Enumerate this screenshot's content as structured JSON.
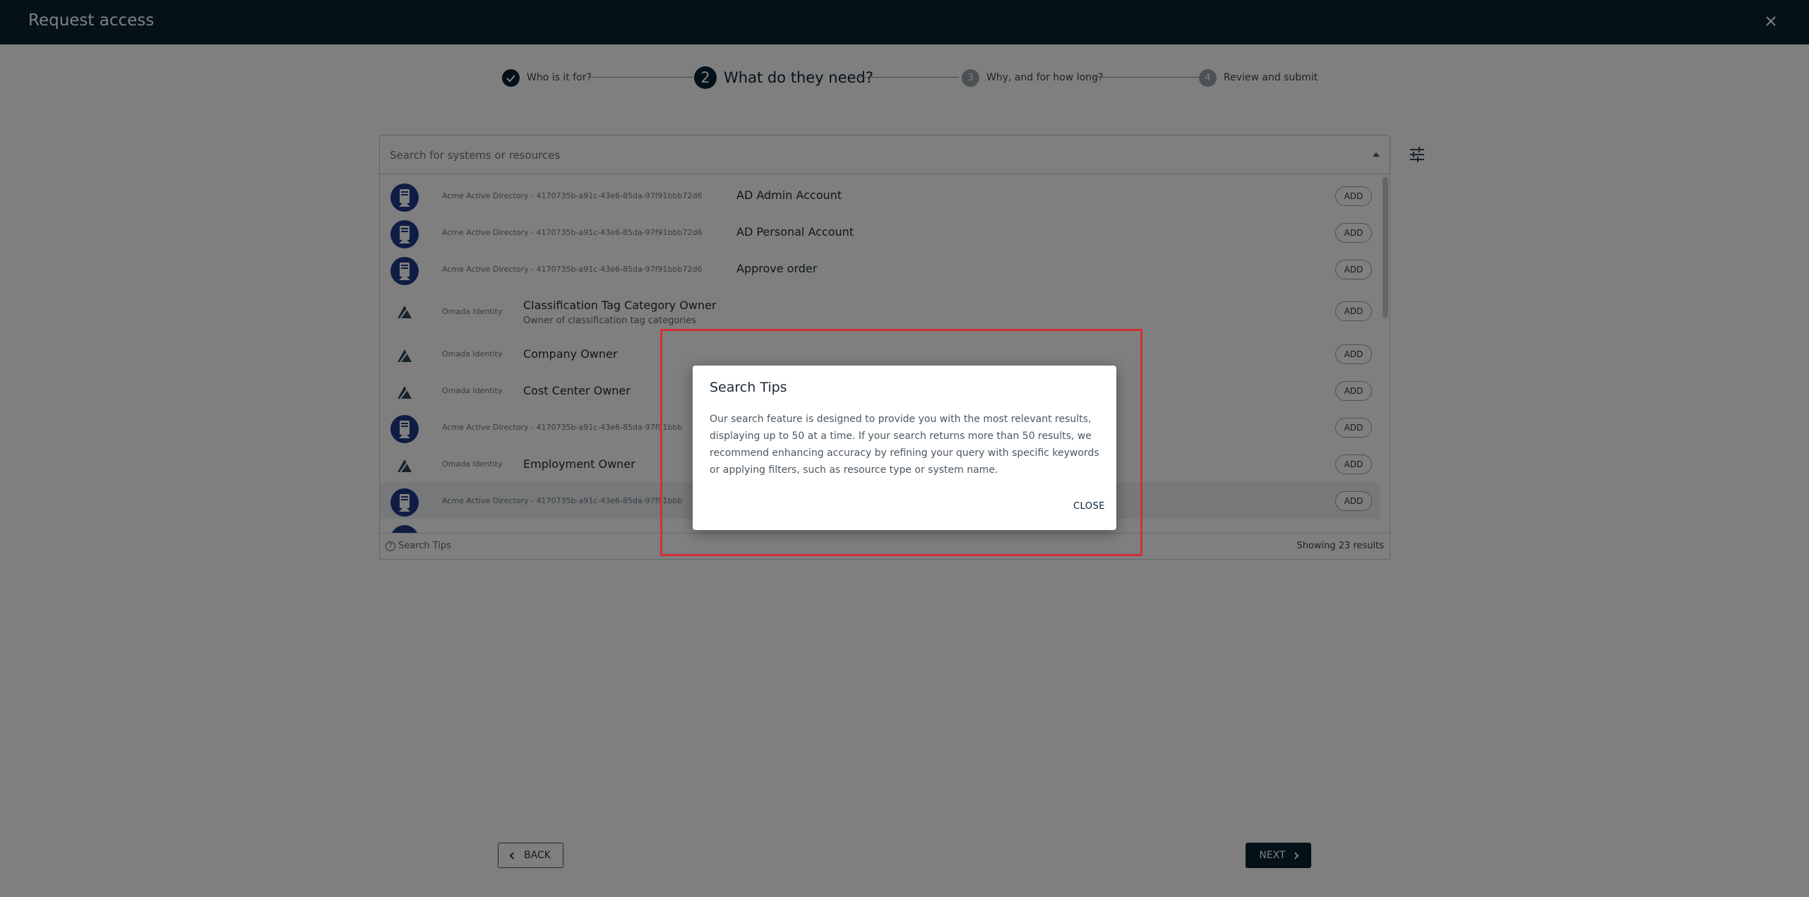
{
  "header": {
    "title": "Request access"
  },
  "stepper": {
    "steps": [
      {
        "number": "1",
        "label": "Who is it for?",
        "state": "done"
      },
      {
        "number": "2",
        "label": "What do they need?",
        "state": "current"
      },
      {
        "number": "3",
        "label": "Why, and for how long?",
        "state": "pending"
      },
      {
        "number": "4",
        "label": "Review and submit",
        "state": "pending"
      }
    ]
  },
  "search": {
    "placeholder": "Search for systems or resources"
  },
  "results": [
    {
      "icon": "active-directory-icon",
      "system": "Acme Active Directory - 4170735b-a91c-43e6-85da-97f91bbb72d6",
      "name": "AD Admin Account",
      "description": "",
      "action": "ADD"
    },
    {
      "icon": "active-directory-icon",
      "system": "Acme Active Directory - 4170735b-a91c-43e6-85da-97f91bbb72d6",
      "name": "AD Personal Account",
      "description": "",
      "action": "ADD"
    },
    {
      "icon": "active-directory-icon",
      "system": "Acme Active Directory - 4170735b-a91c-43e6-85da-97f91bbb72d6",
      "name": "Approve order",
      "description": "",
      "action": "ADD"
    },
    {
      "icon": "omada-identity-icon",
      "system": "Omada Identity",
      "name": "Classification Tag Category Owner",
      "description": "Owner of classification tag categories",
      "action": "ADD"
    },
    {
      "icon": "omada-identity-icon",
      "system": "Omada Identity",
      "name": "Company Owner",
      "description": "",
      "action": "ADD"
    },
    {
      "icon": "omada-identity-icon",
      "system": "Omada Identity",
      "name": "Cost Center Owner",
      "description": "",
      "action": "ADD"
    },
    {
      "icon": "active-directory-icon",
      "system": "Acme Active Directory - 4170735b-a91c-43e6-85da-97f91bbb",
      "name": "",
      "description": "",
      "action": "ADD"
    },
    {
      "icon": "omada-identity-icon",
      "system": "Omada Identity",
      "name": "Employment Owner",
      "description": "",
      "action": "ADD"
    },
    {
      "icon": "active-directory-icon",
      "system": "Acme Active Directory - 4170735b-a91c-43e6-85da-97f91bbb",
      "name": "",
      "description": "",
      "action": "ADD"
    }
  ],
  "footer": {
    "search_tips": "Search Tips",
    "count": "Showing 23 results"
  },
  "nav": {
    "back": "BACK",
    "next": "NEXT"
  },
  "dialog": {
    "title": "Search Tips",
    "body": "Our search feature is designed to provide you with the most relevant results, displaying up to 50 at a time. If your search returns more than 50 results, we recommend enhancing accuracy by refining your query with specific keywords or applying filters, such as resource type or system name.",
    "close": "CLOSE"
  },
  "colors": {
    "navy": "#0b2233",
    "highlight": "#d62f38",
    "ad_icon": "#1f3a8a",
    "omada_icon": "#2f4858"
  }
}
